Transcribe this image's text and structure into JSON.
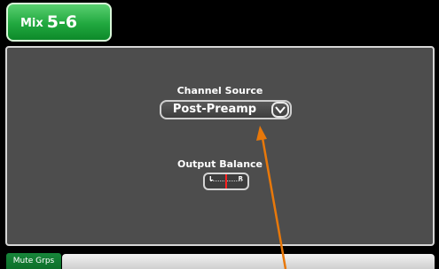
{
  "header": {
    "tab_prefix": "Mix",
    "tab_number": "5-6"
  },
  "panel": {
    "channel_source": {
      "label": "Channel Source",
      "value": "Post-Preamp"
    },
    "output_balance": {
      "label": "Output Balance",
      "left_label": "L",
      "right_label": "R",
      "position": 0.5
    }
  },
  "bottom_tabs": [
    {
      "label": "Mute Grps"
    }
  ],
  "colors": {
    "accent": "#21a83f",
    "marker": "#ff2020",
    "arrow": "#e8780a"
  }
}
